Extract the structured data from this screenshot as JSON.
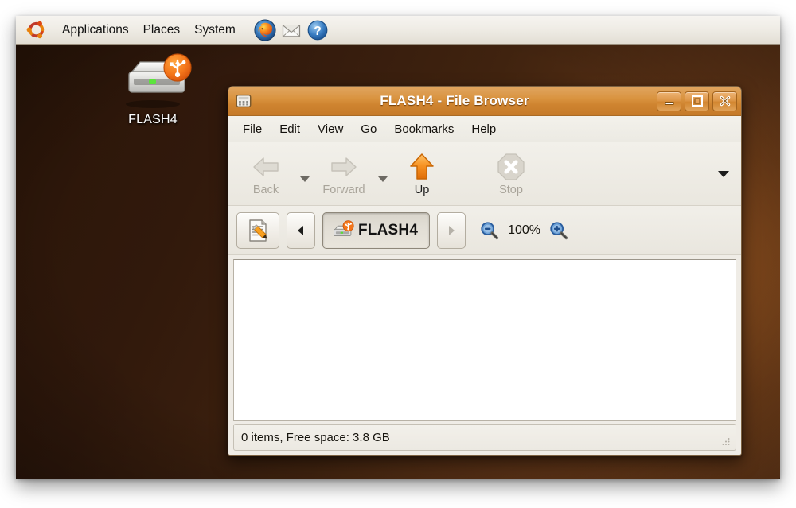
{
  "panel": {
    "logo_icon": "ubuntu-logo-icon",
    "menus": [
      {
        "label": "Applications",
        "name": "panel-menu-applications"
      },
      {
        "label": "Places",
        "name": "panel-menu-places"
      },
      {
        "label": "System",
        "name": "panel-menu-system"
      }
    ],
    "launchers": [
      {
        "name": "firefox-icon",
        "title": "Firefox Web Browser"
      },
      {
        "name": "mail-icon",
        "title": "Evolution Mail"
      },
      {
        "name": "help-icon",
        "title": "Ubuntu Help Center"
      }
    ]
  },
  "desktop": {
    "icons": [
      {
        "label": "FLASH4",
        "icon": "usb-drive-icon"
      }
    ]
  },
  "window": {
    "title": "FLASH4 - File Browser",
    "title_icon": "drive-icon",
    "controls": {
      "minimize": "minimize-icon",
      "maximize": "maximize-icon",
      "close": "close-icon"
    },
    "menubar": [
      {
        "accel": "F",
        "rest": "ile",
        "name": "menu-file"
      },
      {
        "accel": "E",
        "rest": "dit",
        "name": "menu-edit"
      },
      {
        "accel": "V",
        "rest": "iew",
        "name": "menu-view"
      },
      {
        "accel": "G",
        "rest": "o",
        "name": "menu-go"
      },
      {
        "accel": "B",
        "rest": "ookmarks",
        "name": "menu-bookmarks"
      },
      {
        "accel": "H",
        "rest": "elp",
        "name": "menu-help"
      }
    ],
    "toolbar": [
      {
        "label": "Back",
        "icon": "arrow-left-icon",
        "enabled": false,
        "has_dropdown": true
      },
      {
        "label": "Forward",
        "icon": "arrow-right-icon",
        "enabled": false,
        "has_dropdown": true
      },
      {
        "label": "Up",
        "icon": "arrow-up-icon",
        "enabled": true,
        "has_dropdown": false
      },
      {
        "label": "Stop",
        "icon": "stop-icon",
        "enabled": false,
        "has_dropdown": false
      }
    ],
    "toolbar_overflow_icon": "chevron-down-icon",
    "location": {
      "edit_location_icon": "edit-location-icon",
      "path_prev_icon": "triangle-left-icon",
      "path_next_icon": "triangle-right-icon",
      "breadcrumb": {
        "label": "FLASH4",
        "icon": "usb-drive-icon"
      },
      "zoom_out_icon": "zoom-out-icon",
      "zoom_in_icon": "zoom-in-icon",
      "zoom_level": "100%"
    },
    "statusbar": {
      "text": "0 items, Free space: 3.8 GB",
      "resize_grip_icon": "resize-grip-icon"
    }
  },
  "colors": {
    "titlebar_orange": "#d9933f",
    "panel_bg": "#efece5",
    "desktop_brown": "#40230f",
    "accent_orange": "#f07f18"
  }
}
